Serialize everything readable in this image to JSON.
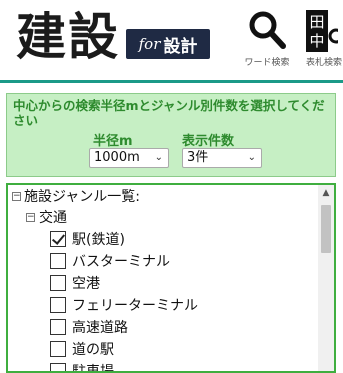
{
  "header": {
    "logo_main": "建設",
    "logo_badge_for": "for",
    "logo_badge_sekkei": "設計",
    "word_search_label": "ワード検索",
    "card_search_label": "表札検索",
    "card_icon_chars": [
      "田",
      "中"
    ],
    "accent_color": "#1b9a88"
  },
  "filter": {
    "instruction": "中心からの検索半径mとジャンル別件数を選択してください",
    "radius_label": "半径m",
    "radius_value": "1000m",
    "count_label": "表示件数",
    "count_value": "3件",
    "panel_color": "#c6efc4",
    "text_color": "#2e8b2e"
  },
  "tree": {
    "root_label": "施設ジャンル一覧:",
    "group_label": "交通",
    "items": [
      {
        "label": "駅(鉄道)",
        "checked": true
      },
      {
        "label": "バスターミナル",
        "checked": false
      },
      {
        "label": "空港",
        "checked": false
      },
      {
        "label": "フェリーターミナル",
        "checked": false
      },
      {
        "label": "高速道路",
        "checked": false
      },
      {
        "label": "道の駅",
        "checked": false
      },
      {
        "label": "駐車場",
        "checked": false
      }
    ],
    "border_color": "#3fae3f"
  }
}
